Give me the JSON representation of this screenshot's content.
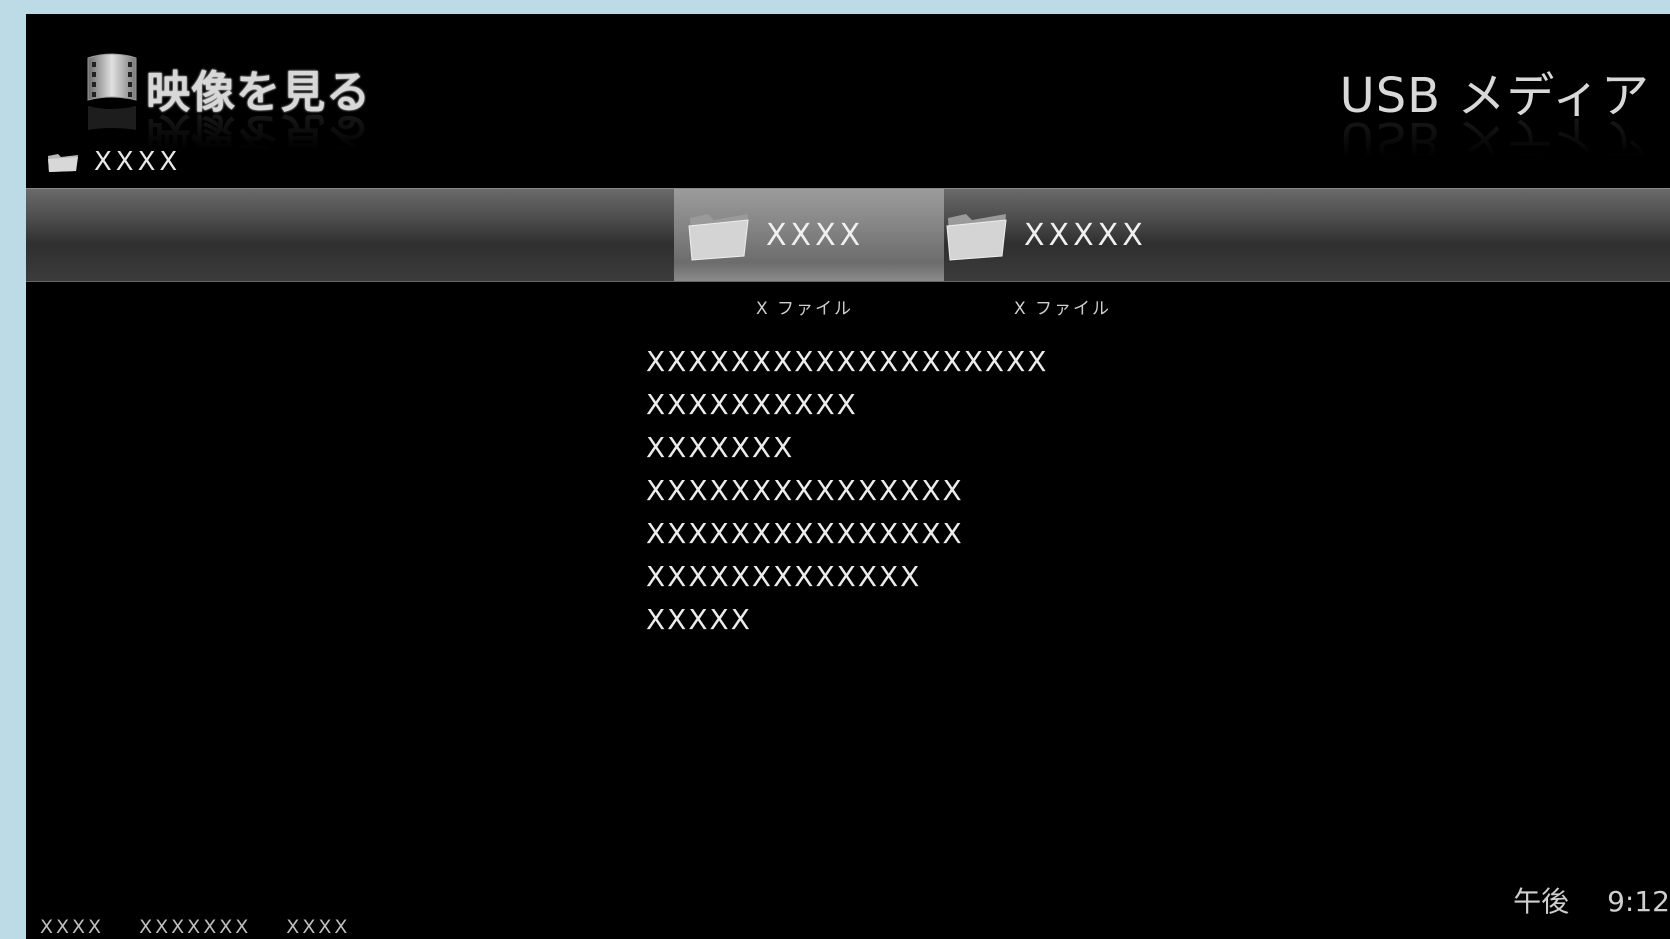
{
  "header": {
    "app_title": "映像を見る",
    "media_title": "USB メディア"
  },
  "breadcrumb": {
    "path": "XXXX"
  },
  "folders": [
    {
      "label": "XXXX",
      "count": "X ファイル",
      "selected": true
    },
    {
      "label": "XXXXX",
      "count": "X ファイル",
      "selected": false
    }
  ],
  "details": [
    "XXXXXXXXXXXXXXXXXXX",
    "XXXXXXXXXX",
    "XXXXXXX",
    "XXXXXXXXXXXXXXX",
    "XXXXXXXXXXXXXXX",
    "XXXXXXXXXXXXX",
    "XXXXX"
  ],
  "clock": {
    "ampm": "午後",
    "time": "9:12"
  },
  "footer": {
    "items": [
      "XXXX",
      "XXXXXXX",
      "XXXX"
    ]
  },
  "icons": {
    "header": "film-reel-icon",
    "breadcrumb": "folder-icon",
    "folder": "folder-icon"
  }
}
